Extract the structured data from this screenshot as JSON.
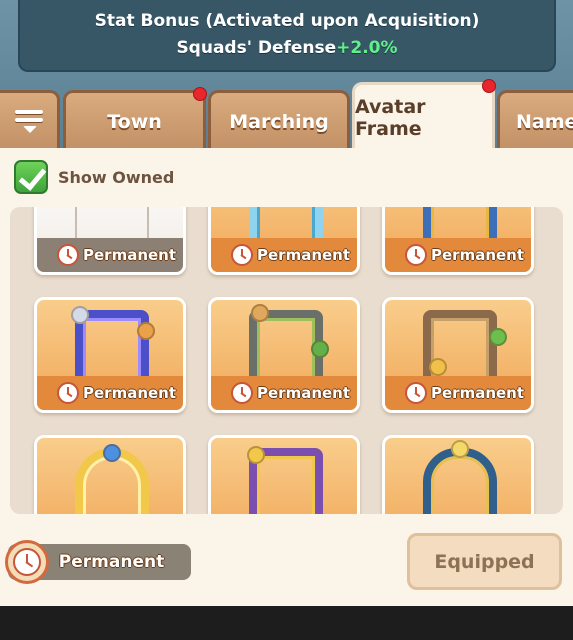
{
  "stat_banner": {
    "title": "Stat Bonus (Activated upon Acquisition)",
    "bonus_label": "Squads' Defense",
    "bonus_value": "+2.0%"
  },
  "tabs": [
    {
      "label": "Town",
      "has_notification": true,
      "active": false
    },
    {
      "label": "Marching",
      "has_notification": false,
      "active": false
    },
    {
      "label": "Avatar Frame",
      "has_notification": true,
      "active": true
    },
    {
      "label": "Namep",
      "has_notification": false,
      "active": false
    }
  ],
  "filter": {
    "show_owned_label": "Show Owned",
    "checked": true
  },
  "frames": [
    {
      "duration": "Permanent",
      "style": "white"
    },
    {
      "duration": "Permanent",
      "style": "icy"
    },
    {
      "duration": "Permanent",
      "style": "blue-gold"
    },
    {
      "duration": "Permanent",
      "style": "space"
    },
    {
      "duration": "Permanent",
      "style": "jungle"
    },
    {
      "duration": "Permanent",
      "style": "forest"
    },
    {
      "duration": "",
      "style": "crown"
    },
    {
      "duration": "",
      "style": "number-one"
    },
    {
      "duration": "",
      "style": "moon"
    }
  ],
  "selected": {
    "duration": "Permanent"
  },
  "equip_button": {
    "label": "Equipped"
  },
  "colors": {
    "accent_green": "#5ff08a",
    "tab_brown": "#c29066",
    "card_orange": "#f0a85a",
    "notification_red": "#e8262b"
  }
}
